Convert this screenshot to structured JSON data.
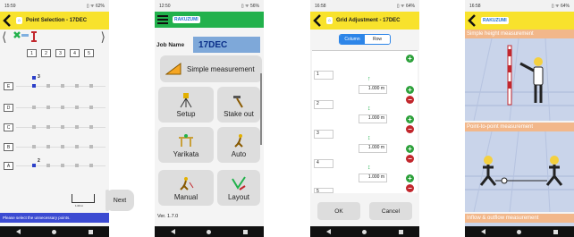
{
  "screens": [
    {
      "status_time": "15:59",
      "status_icons": "▯ ᯤ 62%",
      "title": "Point Selection - 17DEC",
      "col_numbers": [
        "1",
        "2",
        "3",
        "4",
        "5"
      ],
      "row_letters": [
        "E",
        "D",
        "C",
        "B",
        "A"
      ],
      "marker_top": "3",
      "marker_bottom": "2",
      "scale_label": "1.00 m",
      "next_label": "Next",
      "notice": "Please select the unnecessary points."
    },
    {
      "status_time": "12:50",
      "status_icons": "▯ ᯤ 56%",
      "app_logo": "RAKUZUMI",
      "job_name_label": "Job Name",
      "job_name_value": "17DEC",
      "simple_measurement": "Simple measurement",
      "tiles": [
        "Setup",
        "Stake out",
        "Yarikata",
        "Auto",
        "Manual",
        "Layout"
      ],
      "version": "Ver. 1.7.0"
    },
    {
      "status_time": "16:58",
      "status_icons": "▯ ᯤ 64%",
      "title": "Grid Adjustment - 17DEC",
      "segment_column": "Column",
      "segment_row": "Row",
      "rows": [
        "1",
        "2",
        "3",
        "4",
        "5"
      ],
      "distances": [
        "1.000 m",
        "1.000 m",
        "1.000 m",
        "1.000 m"
      ],
      "ok_label": "OK",
      "cancel_label": "Cancel"
    },
    {
      "status_time": "16:58",
      "status_icons": "▯ ᯤ 64%",
      "app_logo": "RAKUZUMI",
      "panels": [
        "Simple height measurement",
        "Point-to-point measurement",
        "Inflow & outflow measurement"
      ]
    }
  ],
  "colors": {
    "yellow": "#f8e22c",
    "green": "#22b14c",
    "blue": "#3c4bd2",
    "orange": "#f2b78a"
  }
}
